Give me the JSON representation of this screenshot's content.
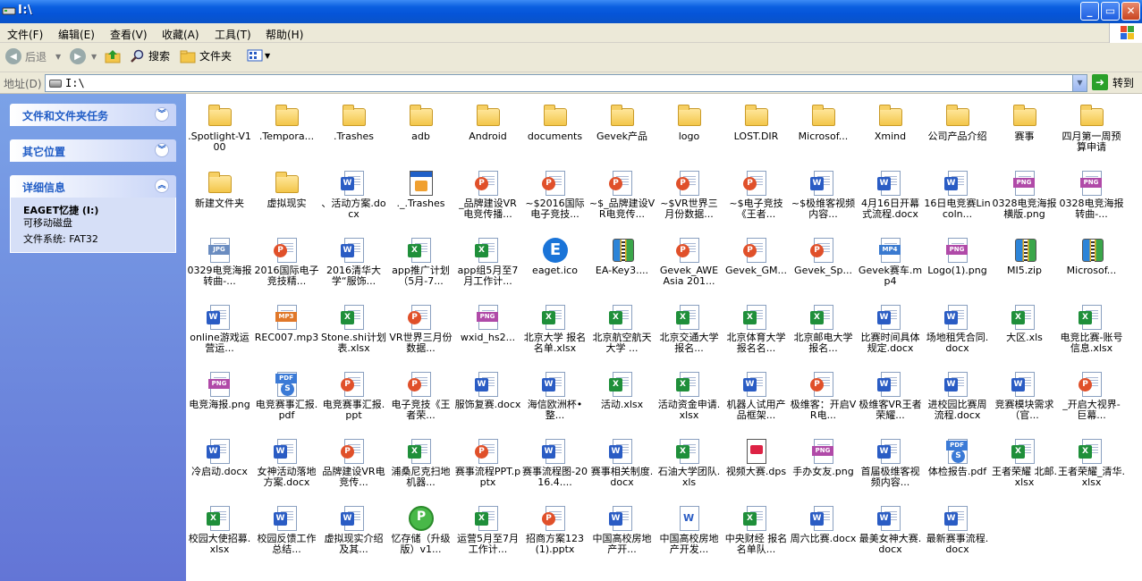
{
  "window": {
    "title": "I:\\"
  },
  "menu": [
    "文件(F)",
    "编辑(E)",
    "查看(V)",
    "收藏(A)",
    "工具(T)",
    "帮助(H)"
  ],
  "toolbar": {
    "back": "后退",
    "search": "搜索",
    "folders": "文件夹"
  },
  "address": {
    "label": "地址(D)",
    "value": "I:\\",
    "go": "转到"
  },
  "left": {
    "tasks": "文件和文件夹任务",
    "other": "其它位置",
    "details": "详细信息",
    "drive_name": "EAGET忆捷 (I:)",
    "drive_type": "可移动磁盘",
    "filesystem": "文件系统: FAT32"
  },
  "files": [
    {
      "n": ".Spotlight-V100",
      "t": "folder"
    },
    {
      "n": ".Tempora...",
      "t": "folder"
    },
    {
      "n": ".Trashes",
      "t": "folder"
    },
    {
      "n": "adb",
      "t": "folder"
    },
    {
      "n": "Android",
      "t": "folder"
    },
    {
      "n": "documents",
      "t": "folder"
    },
    {
      "n": "Gevek产品",
      "t": "folder"
    },
    {
      "n": "logo",
      "t": "folder"
    },
    {
      "n": "LOST.DIR",
      "t": "folder"
    },
    {
      "n": "Microsof...",
      "t": "folder"
    },
    {
      "n": "Xmind",
      "t": "folder"
    },
    {
      "n": "公司产品介绍",
      "t": "folder"
    },
    {
      "n": "赛事",
      "t": "folder"
    },
    {
      "n": "四月第一周预算申请",
      "t": "folder"
    },
    {
      "n": "新建文件夹",
      "t": "folder"
    },
    {
      "n": "虚拟现实",
      "t": "folder"
    },
    {
      "n": "、活动方案.docx",
      "t": "docx"
    },
    {
      "n": "._.Trashes",
      "t": "ico"
    },
    {
      "n": "_品牌建设VR电竞传播...",
      "t": "pptx"
    },
    {
      "n": "~$2016国际电子竞技...",
      "t": "pptx"
    },
    {
      "n": "~$_品牌建设VR电竞传...",
      "t": "pptx"
    },
    {
      "n": "~$VR世界三月份数据...",
      "t": "pptx"
    },
    {
      "n": "~$电子竞技《王者...",
      "t": "pptx"
    },
    {
      "n": "~$极维客视频内容...",
      "t": "docx"
    },
    {
      "n": "4月16日开幕式流程.docx",
      "t": "docx"
    },
    {
      "n": "16日电竞赛Lincoln...",
      "t": "docx"
    },
    {
      "n": "0328电竞海报横版.png",
      "t": "png"
    },
    {
      "n": "0328电竞海报转曲-...",
      "t": "png"
    },
    {
      "n": "0329电竞海报转曲-...",
      "t": "jpg"
    },
    {
      "n": "2016国际电子竞技精...",
      "t": "pptx"
    },
    {
      "n": "2016清华大学“服饰...",
      "t": "docx"
    },
    {
      "n": "app推广计划（5月-7...",
      "t": "xlsx"
    },
    {
      "n": "app组5月至7月工作计...",
      "t": "xlsx"
    },
    {
      "n": "eaget.ico",
      "t": "eaget"
    },
    {
      "n": "EA-Key3....",
      "t": "zip"
    },
    {
      "n": "Gevek_AWE Asia 201...",
      "t": "pptx"
    },
    {
      "n": "Gevek_GM...",
      "t": "pptx"
    },
    {
      "n": "Gevek_Sp...",
      "t": "pptx"
    },
    {
      "n": "Gevek赛车.mp4",
      "t": "mp4"
    },
    {
      "n": "Logo(1).png",
      "t": "png"
    },
    {
      "n": "MI5.zip",
      "t": "zip"
    },
    {
      "n": "Microsof...",
      "t": "zip"
    },
    {
      "n": "online游戏运营运...",
      "t": "docx"
    },
    {
      "n": "REC007.mp3",
      "t": "mp3"
    },
    {
      "n": "Stone.shi计划表.xlsx",
      "t": "xlsx"
    },
    {
      "n": "VR世界三月份数据...",
      "t": "pptx"
    },
    {
      "n": "wxid_hs2...",
      "t": "png"
    },
    {
      "n": "北京大学 报名名单.xlsx",
      "t": "xlsx"
    },
    {
      "n": "北京航空航天大学 ...",
      "t": "xlsx"
    },
    {
      "n": "北京交通大学 报名...",
      "t": "xlsx"
    },
    {
      "n": "北京体育大学报名名...",
      "t": "xlsx"
    },
    {
      "n": "北京邮电大学 报名...",
      "t": "xlsx"
    },
    {
      "n": "比赛时间具体规定.docx",
      "t": "docx"
    },
    {
      "n": "场地租凭合同.docx",
      "t": "docx"
    },
    {
      "n": "大区.xls",
      "t": "xls"
    },
    {
      "n": "电竞比赛-账号信息.xlsx",
      "t": "xlsx"
    },
    {
      "n": "电竞海报.png",
      "t": "png"
    },
    {
      "n": "电竞赛事汇报.pdf",
      "t": "pdf"
    },
    {
      "n": "电竞赛事汇报.ppt",
      "t": "pptx"
    },
    {
      "n": "电子竞技《王者荣...",
      "t": "pptx"
    },
    {
      "n": "服饰复赛.docx",
      "t": "docx"
    },
    {
      "n": "海信欧洲杯•整...",
      "t": "docx"
    },
    {
      "n": "活动.xlsx",
      "t": "xlsx"
    },
    {
      "n": "活动资金申请.xlsx",
      "t": "xlsx"
    },
    {
      "n": "机器人试用产品框架...",
      "t": "docx"
    },
    {
      "n": "极维客：开启VR电...",
      "t": "pptx"
    },
    {
      "n": "极维客VR王者荣耀...",
      "t": "docx"
    },
    {
      "n": "进校园比赛周流程.docx",
      "t": "docx"
    },
    {
      "n": "竞赛模块需求（官...",
      "t": "docx"
    },
    {
      "n": "_开启大视界-巨幕...",
      "t": "pptx"
    },
    {
      "n": "冷启动.docx",
      "t": "docx"
    },
    {
      "n": "女神活动落地方案.docx",
      "t": "docx"
    },
    {
      "n": "品牌建设VR电竞传...",
      "t": "pptx"
    },
    {
      "n": "浦桑尼克扫地机器...",
      "t": "xlsx"
    },
    {
      "n": "赛事流程PPT.pptx",
      "t": "pptx"
    },
    {
      "n": "赛事流程图-2016.4....",
      "t": "docx"
    },
    {
      "n": "赛事相关制度.docx",
      "t": "docx"
    },
    {
      "n": "石油大学团队.xls",
      "t": "xlsx"
    },
    {
      "n": "视频大赛.dps",
      "t": "dps"
    },
    {
      "n": "手办女友.png",
      "t": "png"
    },
    {
      "n": "首届极维客视频内容...",
      "t": "docx"
    },
    {
      "n": "体检报告.pdf",
      "t": "pdf"
    },
    {
      "n": "王者荣耀 北邮.xlsx",
      "t": "xlsx"
    },
    {
      "n": "王者荣耀_清华.xlsx",
      "t": "xlsx"
    },
    {
      "n": "校园大使招募.xlsx",
      "t": "xlsx"
    },
    {
      "n": "校园反馈工作总结...",
      "t": "docx"
    },
    {
      "n": "虚拟现实介绍及其...",
      "t": "docx"
    },
    {
      "n": "忆存储（升级版）v1...",
      "t": "apk"
    },
    {
      "n": "运营5月至7月工作计...",
      "t": "xlsx"
    },
    {
      "n": "招商方案123(1).pptx",
      "t": "pptx"
    },
    {
      "n": "中国高校房地产开...",
      "t": "docx"
    },
    {
      "n": "中国高校房地产开发...",
      "t": "wps"
    },
    {
      "n": "中央财经 报名名单队...",
      "t": "xlsx"
    },
    {
      "n": "周六比赛.docx",
      "t": "docx"
    },
    {
      "n": "最美女神大赛.docx",
      "t": "docx"
    },
    {
      "n": "最新赛事流程.docx",
      "t": "docx"
    }
  ]
}
